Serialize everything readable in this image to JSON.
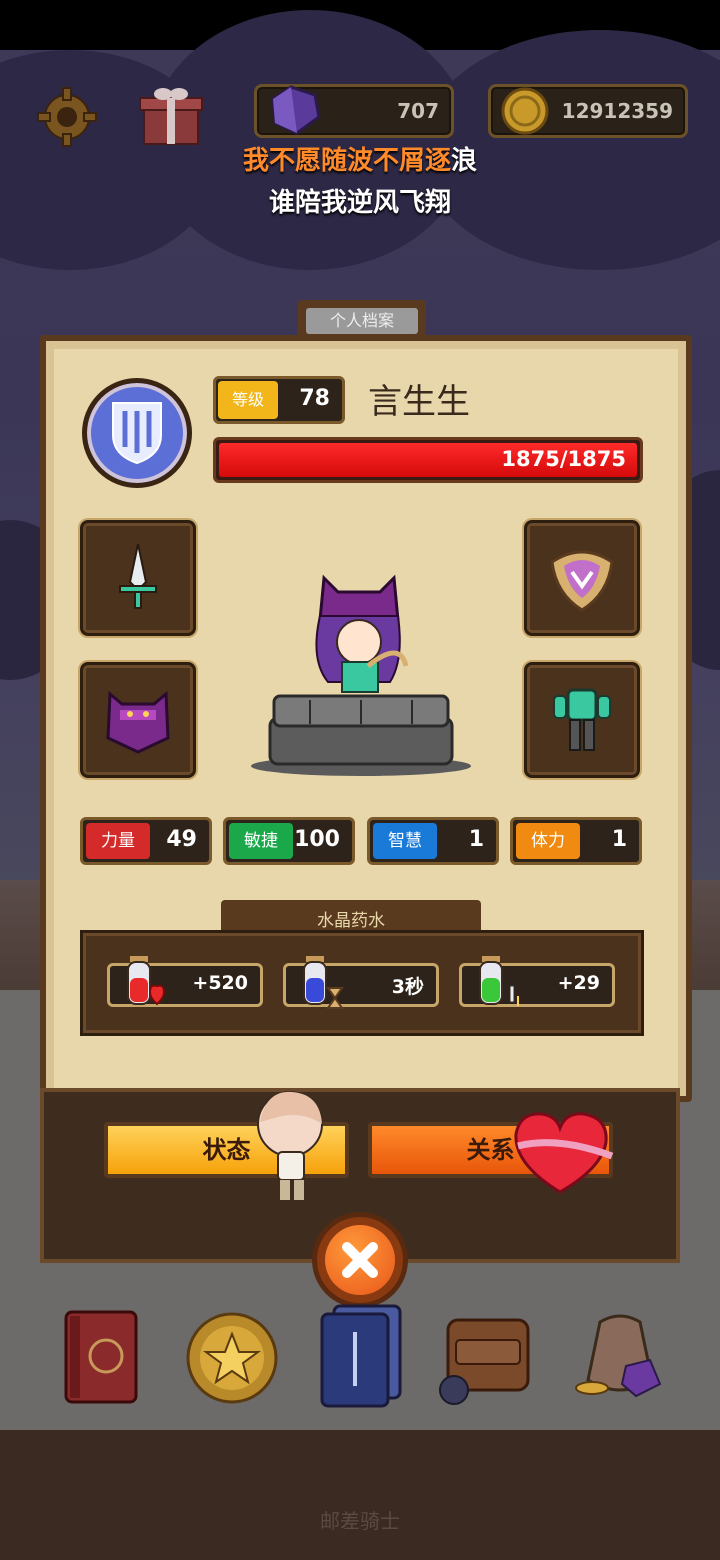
{
  "header": {
    "gem_count": "707",
    "coin_count": "12912359"
  },
  "lyrics": {
    "line1_highlight": "我不愿随波不屑逐",
    "line1_rest": "浪",
    "line2": "谁陪我逆风飞翔"
  },
  "profile": {
    "tab_title": "个人档案",
    "level_label": "等级",
    "level_value": "78",
    "player_name": "言生生",
    "hp_text": "1875/1875",
    "stats": [
      {
        "label": "力量",
        "value": "49",
        "color": "#d42a2a"
      },
      {
        "label": "敏捷",
        "value": "100",
        "color": "#1aa84a"
      },
      {
        "label": "智慧",
        "value": "1",
        "color": "#1a7ad8"
      },
      {
        "label": "体力",
        "value": "1",
        "color": "#f08a10"
      }
    ],
    "potions_title": "水晶药水",
    "potions": [
      {
        "value": "+520",
        "icon": "red-potion-heart-icon"
      },
      {
        "value": "3秒",
        "icon": "blue-potion-hourglass-icon"
      },
      {
        "value": "+29",
        "icon": "green-potion-sword-icon"
      }
    ]
  },
  "buttons": {
    "status": "状态",
    "relation": "关系"
  },
  "footer": {
    "title": "邮差骑士"
  },
  "colors": {
    "highlight_lyric": "#ff8a2a",
    "hp_bar": "#e81a1a",
    "level_label_bg": "#f2b51a"
  }
}
